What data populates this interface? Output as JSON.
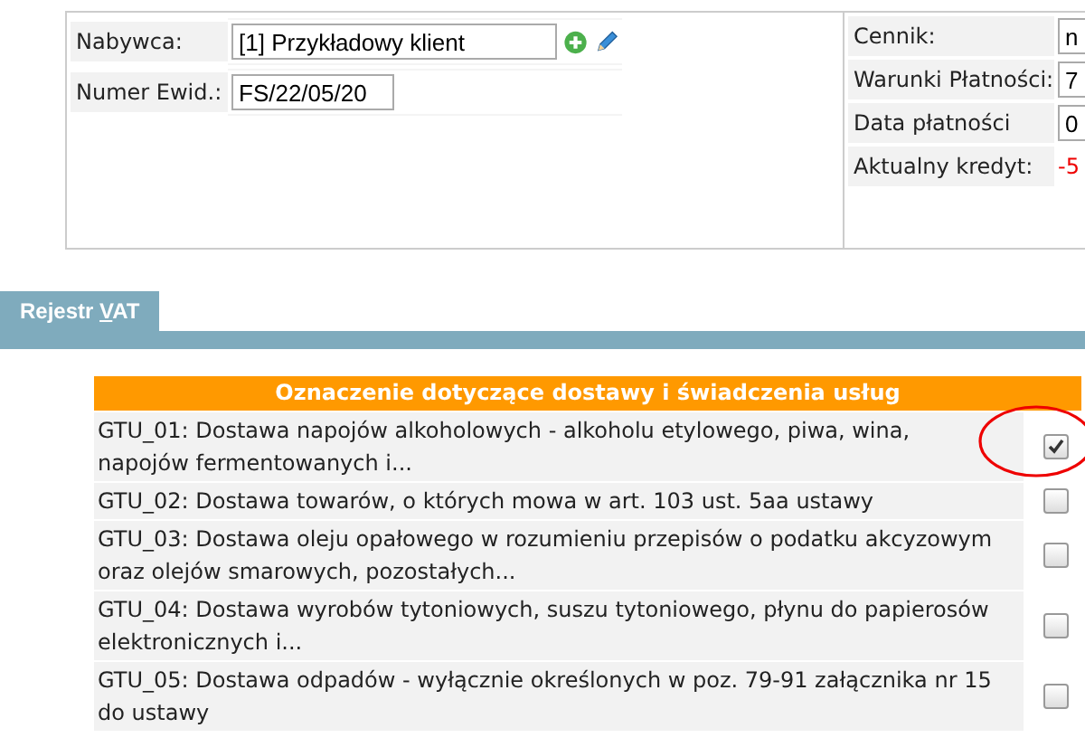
{
  "buyer_panel": {
    "fields": [
      {
        "label": "Nabywca:",
        "value": "[1] Przykładowy klient",
        "kind": "client"
      },
      {
        "label": "Numer Ewid.:",
        "value": "FS/22/05/20",
        "kind": "plain"
      }
    ]
  },
  "payment_panel": {
    "fields": [
      {
        "label": "Cennik:",
        "value": "n",
        "kind": "input"
      },
      {
        "label": "Warunki Płatności:",
        "value": "7",
        "kind": "input"
      },
      {
        "label": "Data płatności",
        "value": "0",
        "kind": "input"
      },
      {
        "label": "Aktualny kredyt:",
        "value": "-5",
        "kind": "amount"
      }
    ]
  },
  "tabs": [
    {
      "label_before": "Rejestr ",
      "label_key": "V",
      "label_after": "AT",
      "selected": true
    }
  ],
  "gtu_table": {
    "title": "Oznaczenie dotyczące dostawy i świadczenia usług",
    "rows": [
      {
        "text": "GTU_01: Dostawa napojów alkoholowych - alkoholu etylowego, piwa, wina, napojów fermentowanych i...",
        "checked": true,
        "highlighted": true
      },
      {
        "text": "GTU_02: Dostawa towarów, o których mowa w art. 103 ust. 5aa ustawy",
        "checked": false,
        "highlighted": false
      },
      {
        "text": "GTU_03: Dostawa oleju opałowego w rozumieniu przepisów o podatku akcyzowym oraz olejów smarowych, pozostałych...",
        "checked": false,
        "highlighted": false
      },
      {
        "text": "GTU_04: Dostawa wyrobów tytoniowych, suszu tytoniowego, płynu do papierosów elektronicznych i...",
        "checked": false,
        "highlighted": false
      },
      {
        "text": "GTU_05: Dostawa odpadów - wyłącznie określonych w poz. 79-91 załącznika nr 15 do ustawy",
        "checked": false,
        "highlighted": false
      }
    ]
  }
}
